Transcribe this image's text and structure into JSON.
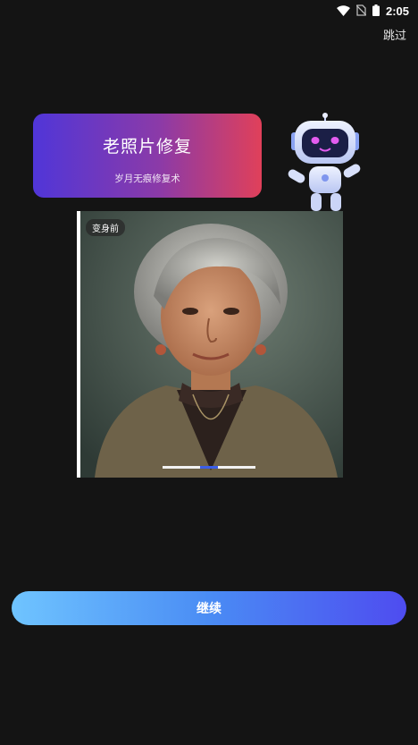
{
  "status_bar": {
    "time": "2:05",
    "icons": [
      "wifi-icon",
      "no-sim-icon",
      "battery-icon"
    ]
  },
  "header": {
    "skip_label": "跳过"
  },
  "card": {
    "title": "老照片修复",
    "subtitle": "岁月无痕修复术",
    "gradient": [
      "#5036d8",
      "#e0405a"
    ]
  },
  "preview": {
    "badge": "变身前",
    "progress": 0.4
  },
  "footer": {
    "continue_label": "继续"
  },
  "colors": {
    "background": "#141414",
    "button_start": "#6fc4ff",
    "button_end": "#4e4cf0"
  }
}
